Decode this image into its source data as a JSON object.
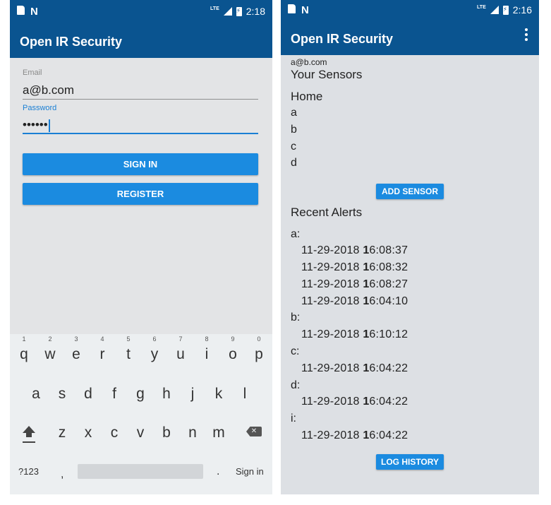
{
  "login_screen": {
    "status": {
      "time": "2:18",
      "network": "LTE"
    },
    "app_title": "Open IR Security",
    "email_label": "Email",
    "email_value": "a@b.com",
    "password_label": "Password",
    "password_value": "••••••",
    "sign_in_label": "SIGN IN",
    "register_label": "REGISTER",
    "keyboard": {
      "row1": [
        {
          "key": "q",
          "hint": "1"
        },
        {
          "key": "w",
          "hint": "2"
        },
        {
          "key": "e",
          "hint": "3"
        },
        {
          "key": "r",
          "hint": "4"
        },
        {
          "key": "t",
          "hint": "5"
        },
        {
          "key": "y",
          "hint": "6"
        },
        {
          "key": "u",
          "hint": "7"
        },
        {
          "key": "i",
          "hint": "8"
        },
        {
          "key": "o",
          "hint": "9"
        },
        {
          "key": "p",
          "hint": "0"
        }
      ],
      "row2": [
        "a",
        "s",
        "d",
        "f",
        "g",
        "h",
        "j",
        "k",
        "l"
      ],
      "row3": [
        "z",
        "x",
        "c",
        "v",
        "b",
        "n",
        "m"
      ],
      "symbols_key": "?123",
      "comma_key": ",",
      "period_key": ".",
      "action_key": "Sign in"
    }
  },
  "sensors_screen": {
    "status": {
      "time": "2:16",
      "network": "LTE"
    },
    "app_title": "Open IR Security",
    "user_email": "a@b.com",
    "your_sensors_heading": "Your Sensors",
    "group_name": "Home",
    "sensors": [
      "a",
      "b",
      "c",
      "d"
    ],
    "add_sensor_label": "ADD SENSOR",
    "recent_alerts_heading": "Recent Alerts",
    "alerts": [
      {
        "sensor": "a:",
        "entries": [
          {
            "date": "11-29-2018 ",
            "hour": "1",
            "rest": "6:08:37"
          },
          {
            "date": "11-29-2018 ",
            "hour": "1",
            "rest": "6:08:32"
          },
          {
            "date": "11-29-2018 ",
            "hour": "1",
            "rest": "6:08:27"
          },
          {
            "date": "11-29-2018 ",
            "hour": "1",
            "rest": "6:04:10"
          }
        ]
      },
      {
        "sensor": "b:",
        "entries": [
          {
            "date": "11-29-2018 ",
            "hour": "1",
            "rest": "6:10:12"
          }
        ]
      },
      {
        "sensor": "c:",
        "entries": [
          {
            "date": "11-29-2018 ",
            "hour": "1",
            "rest": "6:04:22"
          }
        ]
      },
      {
        "sensor": "d:",
        "entries": [
          {
            "date": "11-29-2018 ",
            "hour": "1",
            "rest": "6:04:22"
          }
        ]
      },
      {
        "sensor": "i:",
        "entries": [
          {
            "date": "11-29-2018 ",
            "hour": "1",
            "rest": "6:04:22"
          }
        ]
      }
    ],
    "log_history_label": "LOG HISTORY"
  },
  "colors": {
    "primary": "#0a5490",
    "button": "#1b8be0",
    "focus": "#1a7fd4"
  }
}
